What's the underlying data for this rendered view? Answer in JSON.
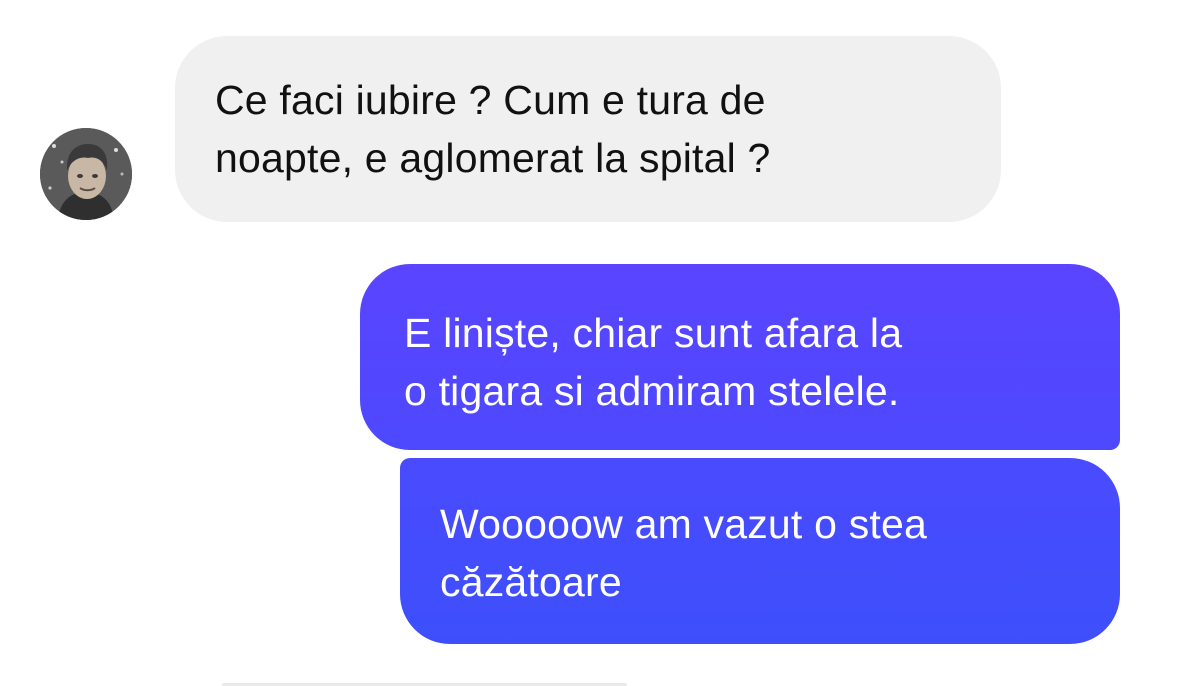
{
  "conversation": {
    "incoming": {
      "avatar_icon": "user-avatar",
      "lines": [
        "Ce faci iubire ? Cum e tura de",
        "noapte, e aglomerat la spital ?"
      ],
      "bubble_color": "#f0f0f0"
    },
    "outgoing": [
      {
        "lines": [
          "E liniște, chiar sunt afara la",
          "o tigara si admiram stelele."
        ],
        "bubble_color": "#5546ff"
      },
      {
        "lines": [
          "Wooooow am vazut o stea",
          "căzătoare"
        ],
        "bubble_color": "#434dfd"
      }
    ]
  }
}
